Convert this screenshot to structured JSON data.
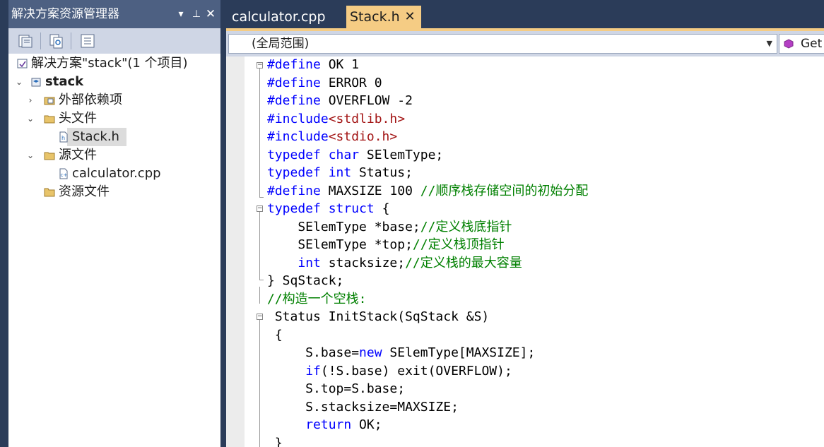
{
  "solution_explorer": {
    "title": "解决方案资源管理器",
    "pin_glyph": "▾",
    "dock_glyph": "⊥",
    "close_glyph": "✕",
    "tree": {
      "solution_label": "解决方案\"stack\"(1 个项目)",
      "project_label": "stack",
      "external_deps_label": "外部依赖项",
      "headers_label": "头文件",
      "stack_h_label": "Stack.h",
      "sources_label": "源文件",
      "calculator_label": "calculator.cpp",
      "resources_label": "资源文件"
    }
  },
  "editor": {
    "tabs": [
      {
        "label": "calculator.cpp",
        "active": false
      },
      {
        "label": "Stack.h",
        "active": true
      }
    ],
    "tab_close_glyph": "✕",
    "scope_value": "(全局范围)",
    "member_value": "Get"
  },
  "code": {
    "l1": {
      "a": "#define",
      "b": " OK 1"
    },
    "l2": {
      "a": "#define",
      "b": " ERROR 0"
    },
    "l3": {
      "a": "#define",
      "b": " OVERFLOW -2"
    },
    "l4": {
      "a": "#include",
      "b": "<stdlib.h>"
    },
    "l5": {
      "a": "#include",
      "b": "<stdio.h>"
    },
    "l6": {
      "a": "typedef",
      "b": " ",
      "c": "char",
      "d": " SElemType;"
    },
    "l7": {
      "a": "typedef",
      "b": " ",
      "c": "int",
      "d": " Status;"
    },
    "l8": {
      "a": "#define",
      "b": " MAXSIZE 100 ",
      "c": "//顺序栈存储空间的初始分配"
    },
    "l9": {
      "a": "typedef",
      "b": " ",
      "c": "struct",
      "d": " {"
    },
    "l10": {
      "a": "    SElemType *base;",
      "b": "//定义栈底指针"
    },
    "l11": {
      "a": "    SElemType *top;",
      "b": "//定义栈顶指针"
    },
    "l12": {
      "a": "    ",
      "b": "int",
      "c": " stacksize;",
      "d": "//定义栈的最大容量"
    },
    "l13": {
      "a": "} SqStack;"
    },
    "l14": {
      "a": "//构造一个空栈:"
    },
    "l15": {
      "a": " Status InitStack(SqStack &S)"
    },
    "l16": {
      "a": " {"
    },
    "l17": {
      "a": "     S.base=",
      "b": "new",
      "c": " SElemType[MAXSIZE];"
    },
    "l18": {
      "a": "     ",
      "b": "if",
      "c": "(!S.base) exit(OVERFLOW);"
    },
    "l19": {
      "a": "     S.top=S.base;"
    },
    "l20": {
      "a": "     S.stacksize=MAXSIZE;"
    },
    "l21": {
      "a": "     ",
      "b": "return",
      "c": " OK;"
    },
    "l22": {
      "a": " }"
    }
  },
  "colors": {
    "chrome": "#2b3c59",
    "active_tab": "#f5cc84",
    "keyword": "#0000ff",
    "string": "#a31515",
    "comment": "#008000"
  }
}
